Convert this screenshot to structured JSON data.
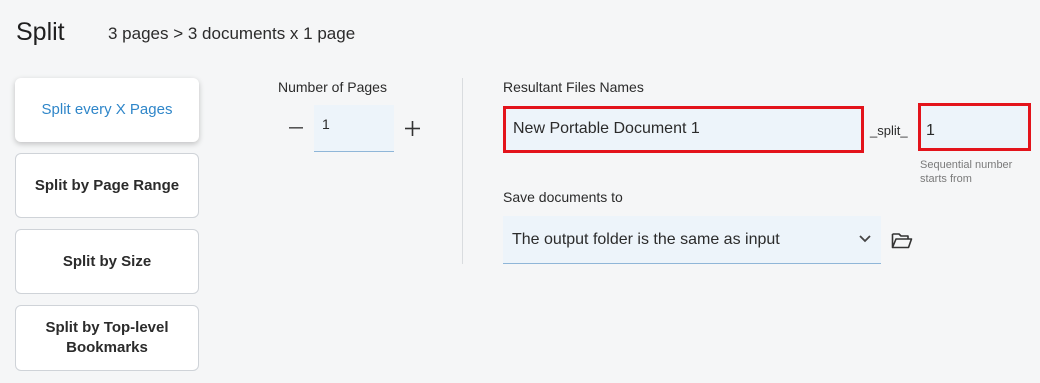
{
  "header": {
    "title": "Split",
    "summary": "3 pages > 3 documents x 1 page"
  },
  "modes": [
    {
      "label": "Split every X Pages",
      "active": true
    },
    {
      "label": "Split by Page Range",
      "active": false
    },
    {
      "label": "Split by Size",
      "active": false
    },
    {
      "label": "Split by Top-level Bookmarks",
      "active": false
    }
  ],
  "number_of_pages": {
    "label": "Number of Pages",
    "value": "1",
    "decrement_icon": "minus-icon",
    "increment_icon": "plus-icon"
  },
  "resultant_files": {
    "label": "Resultant Files Names",
    "base_name": "New Portable Document 1",
    "separator": "_split_",
    "sequence_start": "1",
    "sequence_hint": "Sequential number starts from"
  },
  "save_to": {
    "label": "Save documents to",
    "selected": "The output folder is the same as input",
    "dropdown_icon": "chevron-down-icon",
    "browse_icon": "folder-open-icon"
  },
  "colors": {
    "accent": "#2f86c9",
    "highlight_border": "#e3131b",
    "field_bg": "#edf4fa"
  }
}
